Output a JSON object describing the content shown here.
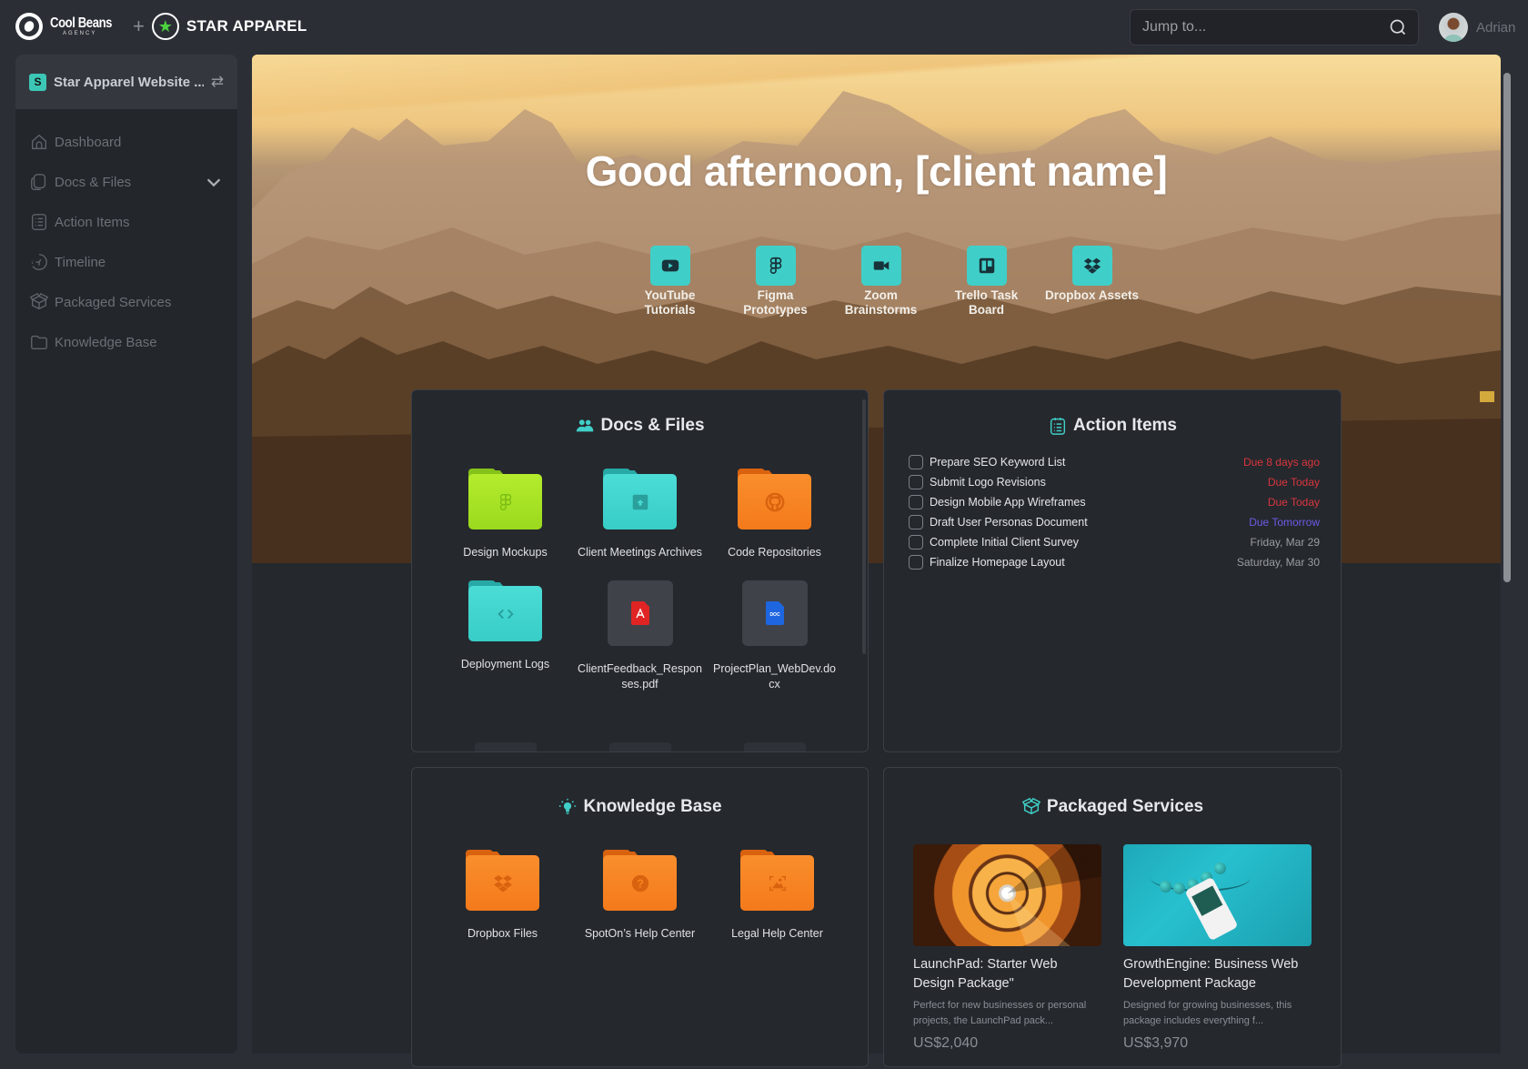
{
  "topbar": {
    "agency_name": "Cool Beans",
    "agency_sub": "AGENCY",
    "plus": "+",
    "client_brand": "STAR APPAREL",
    "search_placeholder": "Jump to...",
    "user_name": "Adrian"
  },
  "sidebar": {
    "workspace_badge": "S",
    "workspace_title": "Star Apparel Website ...",
    "items": [
      {
        "label": "Dashboard",
        "icon": "home-icon"
      },
      {
        "label": "Docs & Files",
        "icon": "documents-icon",
        "expandable": true
      },
      {
        "label": "Action Items",
        "icon": "checklist-icon"
      },
      {
        "label": "Timeline",
        "icon": "timeline-icon"
      },
      {
        "label": "Packaged Services",
        "icon": "package-icon"
      },
      {
        "label": "Knowledge Base",
        "icon": "folder-icon"
      }
    ]
  },
  "hero": {
    "greeting": "Good afternoon, [client name]",
    "apps": [
      {
        "label": "YouTube Tutorials",
        "icon": "youtube-icon"
      },
      {
        "label": "Figma Prototypes",
        "icon": "figma-icon"
      },
      {
        "label": "Zoom Brainstorms",
        "icon": "zoom-video-icon"
      },
      {
        "label": "Trello Task Board",
        "icon": "trello-icon"
      },
      {
        "label": "Dropbox Assets",
        "icon": "dropbox-icon"
      }
    ]
  },
  "docs": {
    "title": "Docs & Files",
    "items": [
      {
        "label": "Design Mockups",
        "type": "folder",
        "color": "#a6e22e",
        "icon": "figma-icon"
      },
      {
        "label": "Client Meetings Archives",
        "type": "folder",
        "color": "#3fd6d0",
        "icon": "archive-icon"
      },
      {
        "label": "Code Repositories",
        "type": "folder",
        "color": "#f7841f",
        "icon": "github-icon"
      },
      {
        "label": "Deployment Logs",
        "type": "folder",
        "color": "#3fd6d0",
        "icon": "code-icon"
      },
      {
        "label": "ClientFeedback_Responses.pdf",
        "type": "file",
        "icon": "pdf-file-icon"
      },
      {
        "label": "ProjectPlan_WebDev.docx",
        "type": "file",
        "icon": "doc-file-icon"
      }
    ]
  },
  "actions": {
    "title": "Action Items",
    "items": [
      {
        "task": "Prepare SEO Keyword List",
        "due": "Due 8 days ago",
        "color": "#d9363e"
      },
      {
        "task": "Submit Logo Revisions",
        "due": "Due Today",
        "color": "#d9363e"
      },
      {
        "task": "Design Mobile App Wireframes",
        "due": "Due Today",
        "color": "#d9363e"
      },
      {
        "task": "Draft User Personas Document",
        "due": "Due Tomorrow",
        "color": "#6b5ce7"
      },
      {
        "task": "Complete Initial Client Survey",
        "due": "Friday, Mar 29",
        "color": "#9a9da3"
      },
      {
        "task": "Finalize Homepage Layout",
        "due": "Saturday, Mar 30",
        "color": "#9a9da3"
      }
    ]
  },
  "knowledge": {
    "title": "Knowledge Base",
    "items": [
      {
        "label": "Dropbox Files",
        "icon": "dropbox-icon",
        "color": "#f7841f"
      },
      {
        "label": "SpotOn’s Help Center",
        "icon": "help-icon",
        "color": "#f7841f"
      },
      {
        "label": "Legal Help Center",
        "icon": "image-frame-icon",
        "color": "#f7841f"
      }
    ]
  },
  "services": {
    "title": "Packaged Services",
    "items": [
      {
        "title": "LaunchPad: Starter Web Design Package\"",
        "desc": "Perfect for new businesses or personal projects, the LaunchPad pack...",
        "price": "US$2,040"
      },
      {
        "title": "GrowthEngine: Business Web Development Package",
        "desc": "Designed for growing businesses, this package includes everything f...",
        "price": "US$3,970"
      }
    ]
  },
  "colors": {
    "accent": "#40cfc8",
    "overdue": "#d9363e",
    "upcoming": "#6b5ce7"
  }
}
